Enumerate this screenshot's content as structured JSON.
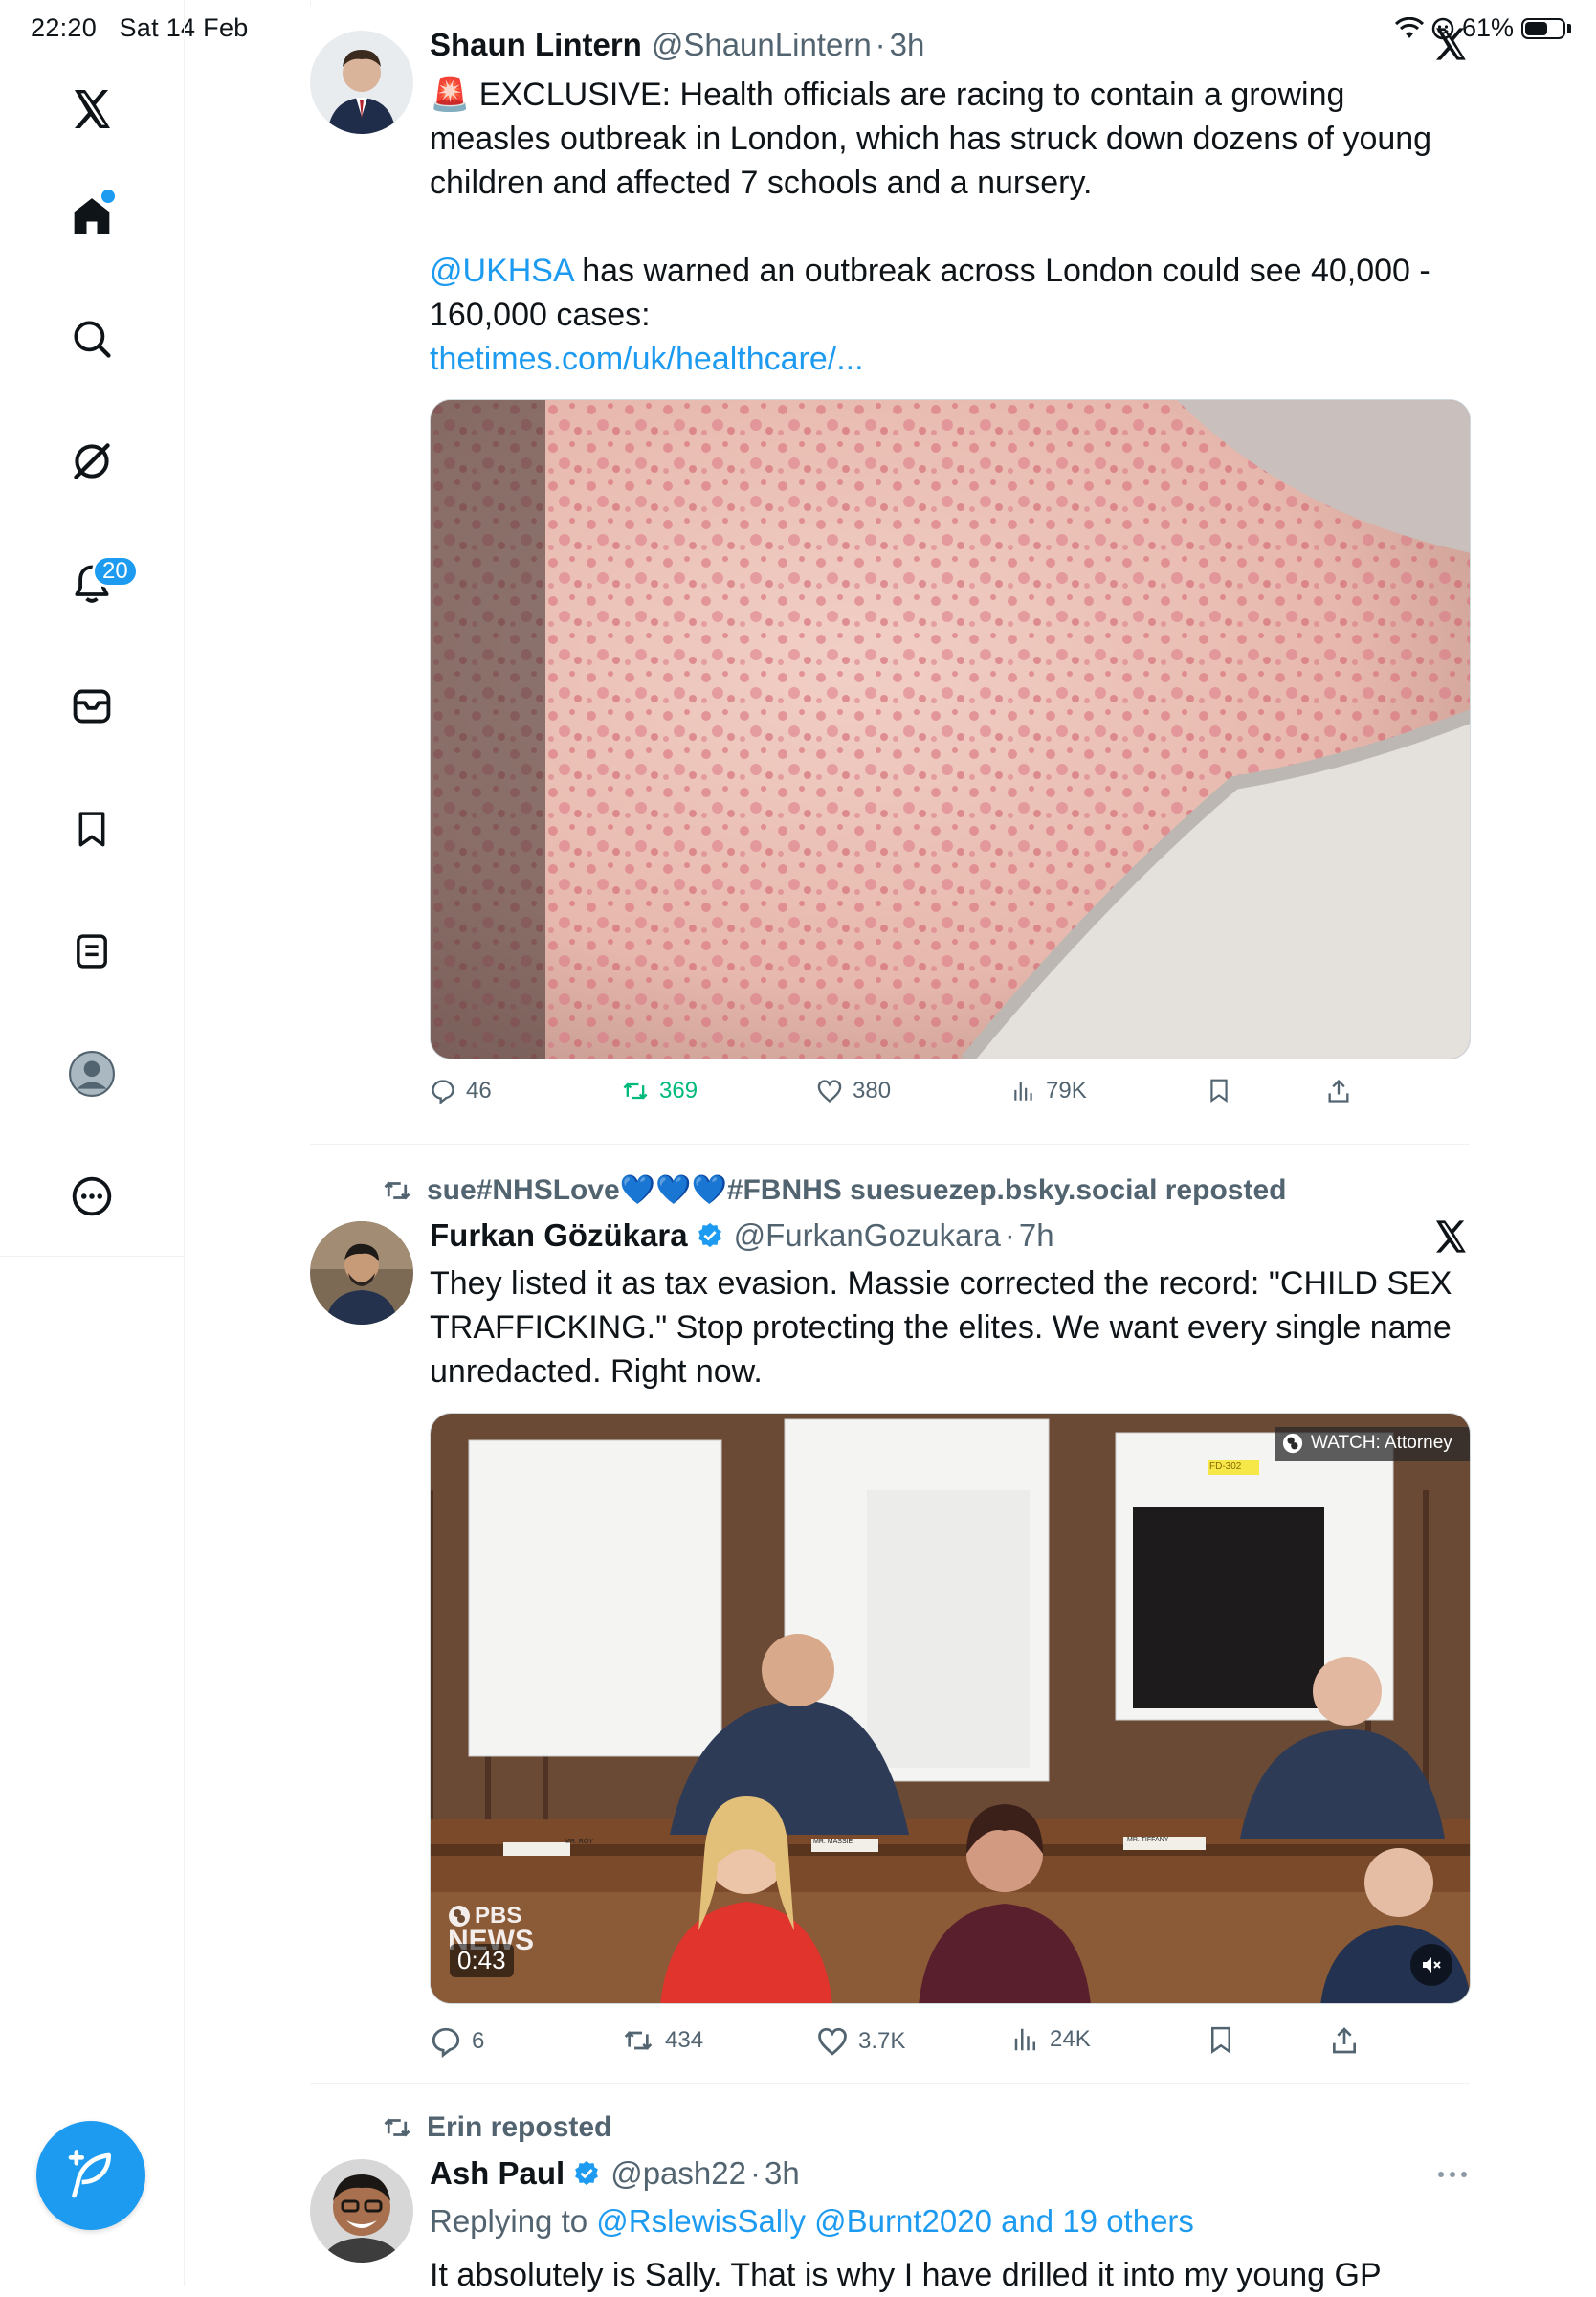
{
  "status_bar": {
    "time": "22:20",
    "date": "Sat 14 Feb",
    "battery": "61%",
    "battery_level": 0.61
  },
  "sidebar": {
    "items": [
      {
        "name": "x-logo",
        "icon": "x-logo-icon"
      },
      {
        "name": "home",
        "icon": "home-icon",
        "active": true
      },
      {
        "name": "explore",
        "icon": "search-icon"
      },
      {
        "name": "grok",
        "icon": "grok-icon"
      },
      {
        "name": "notifications",
        "icon": "bell-icon",
        "badge": "20"
      },
      {
        "name": "messages",
        "icon": "envelope-icon"
      },
      {
        "name": "bookmarks",
        "icon": "bookmark-icon"
      },
      {
        "name": "lists",
        "icon": "list-icon"
      },
      {
        "name": "profile",
        "icon": "profile-icon"
      },
      {
        "name": "more",
        "icon": "more-circle-icon"
      }
    ],
    "compose_icon": "compose-feather-icon"
  },
  "colors": {
    "accent": "#1d9bf0",
    "repost_green": "#00ba7c",
    "secondary_text": "#536471"
  },
  "posts": [
    {
      "author": "Shaun Lintern",
      "handle": "@ShaunLintern",
      "time": "3h",
      "emoji": "🚨",
      "text_p1": "EXCLUSIVE: Health officials are racing to contain a growing measles outbreak in London, which has struck down dozens of young children and affected 7 schools and a nursery.",
      "mention": "@UKHSA",
      "text_p2": " has warned an outbreak across London could see 40,000 - 160,000 cases:",
      "link": "thetimes.com/uk/healthcare/...",
      "stats": {
        "replies": "46",
        "reposts": "369",
        "likes": "380",
        "views": "79K"
      }
    },
    {
      "reposted_by": "sue#NHSLove💙💙💙#FBNHS suesuezep.bsky.social reposted",
      "author": "Furkan Gözükara",
      "handle": "@FurkanGozukara",
      "time": "7h",
      "text": "They listed it as tax evasion. Massie corrected the record: \"CHILD SEX TRAFFICKING.\" Stop protecting the elites. We want every single name unredacted. Right now.",
      "video": {
        "watch_label": "WATCH: Attorney",
        "network": "PBS",
        "network2": "NEWS",
        "duration": "0:43",
        "sign_left": "MR. ROY",
        "sign_mid": "MR. MASSIE",
        "sign_right": "MR. TIFFANY",
        "tag": "FD-302"
      },
      "stats": {
        "replies": "6",
        "reposts": "434",
        "likes": "3.7K",
        "views": "24K"
      }
    },
    {
      "reposted_by": "Erin reposted",
      "author": "Ash Paul",
      "handle": "@pash22",
      "time": "3h",
      "replying_prefix": "Replying to ",
      "replying_to": "@RslewisSally @Burnt2020 and 19 others",
      "text": "It absolutely is Sally. That is why I have drilled it into my young GP"
    }
  ]
}
